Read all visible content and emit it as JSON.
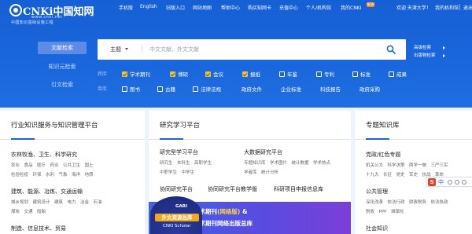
{
  "brand": {
    "logo_main": "CNKi中国知网",
    "logo_url": "www.cnki.net",
    "logo_sub": "中国知识基础设施工程"
  },
  "topnav": {
    "items": [
      "手机版",
      "English",
      "旧版入口",
      "网站地图",
      "帮助中心",
      "购买知网卡",
      "充值中心",
      "个人/机构馆",
      "我的CNKI"
    ],
    "new_badge": "NEW",
    "welcome": "欢迎 天津大学！",
    "my_org": "我的机构馆",
    "logout": "退出"
  },
  "side_tabs": [
    "文献检索",
    "知识元检索",
    "引文检索"
  ],
  "search": {
    "field": "主题",
    "placeholder": "中文文献、外文文献",
    "advanced": "高级检索",
    "publication": "出版物检索"
  },
  "filters": {
    "library_label": "跨库",
    "library_items": [
      {
        "label": "学术期刊",
        "checked": true
      },
      {
        "label": "博硕",
        "checked": true
      },
      {
        "label": "会议",
        "checked": true
      },
      {
        "label": "报纸",
        "checked": true
      },
      {
        "label": "年鉴",
        "checked": false
      },
      {
        "label": "专利",
        "checked": false
      },
      {
        "label": "标准",
        "checked": false
      },
      {
        "label": "成果",
        "checked": false
      }
    ],
    "single_label": "单库",
    "single_items": [
      {
        "label": "图书",
        "checked": false
      },
      {
        "label": "古籍",
        "checked": false
      },
      {
        "label": "法律法规",
        "checked": false
      },
      {
        "label": "政府文件"
      },
      {
        "label": "企业标准"
      },
      {
        "label": "科技报告"
      },
      {
        "label": "政府采购"
      }
    ]
  },
  "card1": {
    "title": "行业知识服务与知识管理平台",
    "groups": [
      {
        "heading": "农林牧渔、卫生、科学研究",
        "row1": "农业　食品　医疗　药业　公共卫生　国土",
        "row2": "检验检疫　环保　水利　气象　海洋　地质"
      },
      {
        "heading": "建筑、能源、冶炼、交通运输",
        "row1": "城乡规划　建筑设计　建筑　电力　冶金　石油",
        "row2": "煤炭　交通　船舶"
      },
      {
        "heading": "制造、信息技术、贸易",
        "row1": "",
        "row2": ""
      }
    ]
  },
  "card2": {
    "title": "研究学习平台",
    "left": [
      {
        "heading": "研究型学习平台",
        "sub1": "研究生　本科生　高职学生",
        "sub2": "中职学生　中学生"
      },
      {
        "heading": "协同研究平台"
      }
    ],
    "right": [
      {
        "heading": "大数据研究平台",
        "sub1": "专题知识库　学术图片　统计数据　学术热点",
        "sub2": "学者库　统计分析"
      },
      {
        "heading": "协同研究平台教学版"
      }
    ],
    "mid_heading": "科研项目申报信息库",
    "banner_line1": "中国学术期刊",
    "banner_line1_hl": "(网络版)",
    "banner_line1_end": " &",
    "banner_line2": "中国学术期刊网络出版总库",
    "gari_title": "GARI",
    "gari_main": "外文资源总库",
    "gari_sub": "CNKI Scholar"
  },
  "card3": {
    "title": "专题知识库",
    "groups": [
      {
        "heading": "党政/红色专题",
        "row1": "机关公文　科学决策　两学一做　三严三实",
        "row2": "十九大　长征　党史　军史　抗战　革命"
      },
      {
        "heading": "公共管理",
        "row1": "深化改革　依法行政　财政税务　依法执政",
        "row2": "税收　PPP　城镇化"
      },
      {
        "heading": "社会知识",
        "row1": "",
        "row2": ""
      }
    ]
  },
  "ime": {
    "logo": "S",
    "lang": "中"
  },
  "colors": {
    "primary": "#1a66dc",
    "accent_yellow": "#f8c11c",
    "new_badge": "#ff8a1f"
  }
}
